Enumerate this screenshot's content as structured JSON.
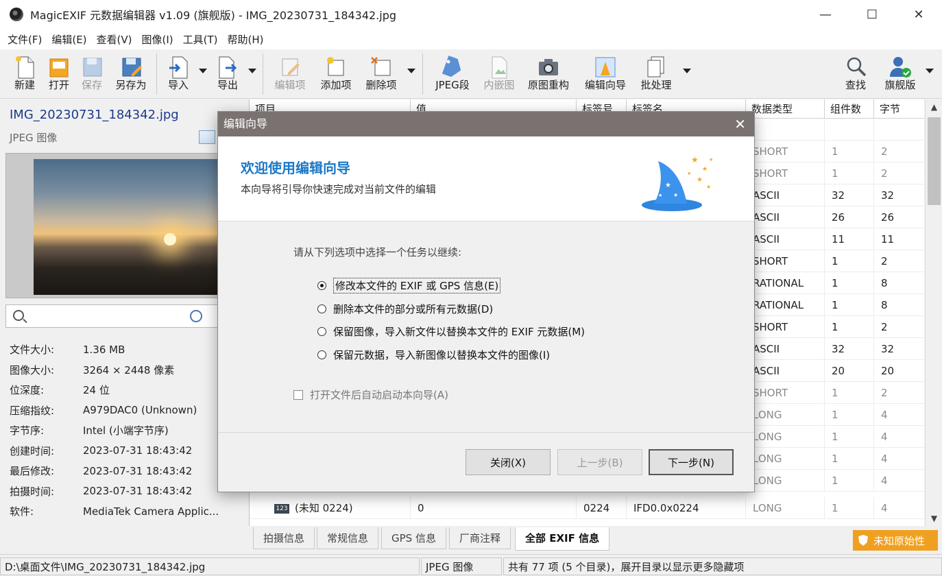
{
  "window": {
    "title": "MagicEXIF 元数据编辑器 v1.09 (旗舰版) - IMG_20230731_184342.jpg",
    "minimize": "—",
    "maximize": "☐",
    "close": "✕"
  },
  "menu": [
    "文件(F)",
    "编辑(E)",
    "查看(V)",
    "图像(I)",
    "工具(T)",
    "帮助(H)"
  ],
  "toolbar": {
    "new": "新建",
    "open": "打开",
    "save": "保存",
    "save_as": "另存为",
    "import": "导入",
    "export": "导出",
    "edit_item": "编辑项",
    "add_item": "添加项",
    "delete_item": "删除项",
    "jpeg_segment": "JPEG段",
    "embedded": "内嵌图",
    "rebuild": "原图重构",
    "edit_wizard": "编辑向导",
    "batch": "批处理",
    "find": "查找",
    "edition": "旗舰版"
  },
  "file": {
    "name": "IMG_20230731_184342.jpg",
    "type": "JPEG 图像"
  },
  "search": {
    "placeholder": ""
  },
  "info": [
    {
      "label": "文件大小:",
      "value": "1.36 MB"
    },
    {
      "label": "图像大小:",
      "value": "3264 × 2448 像素"
    },
    {
      "label": "位深度:",
      "value": "24 位"
    },
    {
      "label": "压缩指纹:",
      "value": "A979DAC0 (Unknown)"
    },
    {
      "label": "字节序:",
      "value": "Intel (小端字节序)"
    },
    {
      "label": "创建时间:",
      "value": "2023-07-31 18:43:42"
    },
    {
      "label": "最后修改:",
      "value": "2023-07-31 18:43:42"
    },
    {
      "label": "拍摄时间:",
      "value": "2023-07-31 18:43:42"
    },
    {
      "label": "软件:",
      "value": "MediaTek Camera Applic..."
    }
  ],
  "table": {
    "headers": [
      "项目",
      "值",
      "标签号",
      "标签名",
      "数据类型",
      "组件数",
      "字节"
    ],
    "rows": [
      {
        "type": "",
        "count": "",
        "bytes": "",
        "muted": false
      },
      {
        "type": "SHORT",
        "count": "1",
        "bytes": "2",
        "muted": true
      },
      {
        "type": "SHORT",
        "count": "1",
        "bytes": "2",
        "muted": true
      },
      {
        "type": "ASCII",
        "count": "32",
        "bytes": "32",
        "muted": false
      },
      {
        "type": "ASCII",
        "count": "26",
        "bytes": "26",
        "muted": false
      },
      {
        "type": "ASCII",
        "count": "11",
        "bytes": "11",
        "muted": false
      },
      {
        "type": "SHORT",
        "count": "1",
        "bytes": "2",
        "muted": false
      },
      {
        "type": "RATIONAL",
        "count": "1",
        "bytes": "8",
        "muted": false
      },
      {
        "type": "RATIONAL",
        "count": "1",
        "bytes": "8",
        "muted": false
      },
      {
        "type": "SHORT",
        "count": "1",
        "bytes": "2",
        "muted": false
      },
      {
        "type": "ASCII",
        "count": "32",
        "bytes": "32",
        "muted": false
      },
      {
        "type": "ASCII",
        "count": "20",
        "bytes": "20",
        "muted": false
      },
      {
        "type": "SHORT",
        "count": "1",
        "bytes": "2",
        "muted": true
      },
      {
        "type": "LONG",
        "count": "1",
        "bytes": "4",
        "muted": true
      },
      {
        "type": "LONG",
        "count": "1",
        "bytes": "4",
        "muted": true
      },
      {
        "type": "LONG",
        "count": "1",
        "bytes": "4",
        "muted": true
      },
      {
        "type": "LONG",
        "count": "1",
        "bytes": "4",
        "muted": true
      }
    ],
    "last_row": {
      "icon": "123",
      "item": "(未知 0224)",
      "value": "0",
      "tag": "0224",
      "tagname": "IFD0.0x0224",
      "type": "LONG",
      "count": "1",
      "bytes": "4"
    }
  },
  "tabs": [
    "拍摄信息",
    "常规信息",
    "GPS 信息",
    "厂商注释",
    "全部 EXIF 信息"
  ],
  "badge": "未知原始性",
  "status": {
    "path": "D:\\桌面文件\\IMG_20230731_184342.jpg",
    "format": "JPEG 图像",
    "summary": "共有 77 项 (5 个目录)，展开目录以显示更多隐藏项"
  },
  "dialog": {
    "title": "编辑向导",
    "heading": "欢迎使用编辑向导",
    "subtitle": "本向导将引导你快速完成对当前文件的编辑",
    "prompt": "请从下列选项中选择一个任务以继续:",
    "options": [
      "修改本文件的 EXIF 或 GPS 信息(E)",
      "删除本文件的部分或所有元数据(D)",
      "保留图像，导入新文件以替换本文件的 EXIF 元数据(M)",
      "保留元数据，导入新图像以替换本文件的图像(I)"
    ],
    "auto_start": "打开文件后自动启动本向导(A)",
    "btn_close": "关闭(X)",
    "btn_prev": "上一步(B)",
    "btn_next": "下一步(N)"
  }
}
